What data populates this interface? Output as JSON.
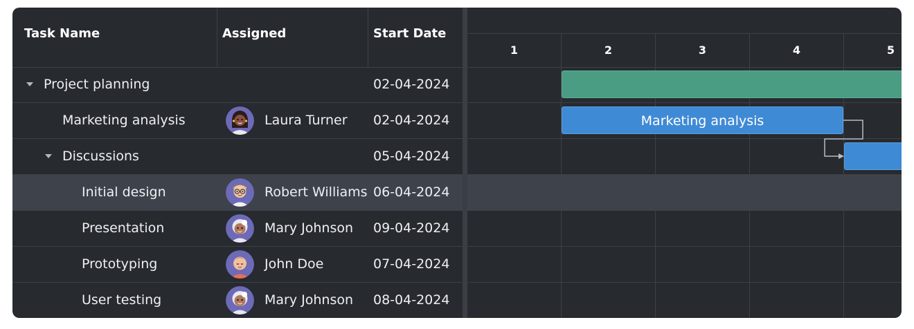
{
  "columns": {
    "task_name": "Task Name",
    "assigned": "Assigned",
    "start_date": "Start Date"
  },
  "timeline": {
    "days": [
      "1",
      "2",
      "3",
      "4",
      "5"
    ]
  },
  "rows": [
    {
      "name": "Project planning",
      "assigned": "",
      "start": "02-04-2024",
      "level": 0,
      "expandable": true,
      "selected": false
    },
    {
      "name": "Marketing analysis",
      "assigned": "Laura Turner",
      "start": "02-04-2024",
      "level": 1,
      "expandable": false,
      "selected": false
    },
    {
      "name": "Discussions",
      "assigned": "",
      "start": "05-04-2024",
      "level": 1,
      "expandable": true,
      "selected": false
    },
    {
      "name": "Initial design",
      "assigned": "Robert Williams",
      "start": "06-04-2024",
      "level": 2,
      "expandable": false,
      "selected": true
    },
    {
      "name": "Presentation",
      "assigned": "Mary Johnson",
      "start": "09-04-2024",
      "level": 2,
      "expandable": false,
      "selected": false
    },
    {
      "name": "Prototyping",
      "assigned": "John Doe",
      "start": "07-04-2024",
      "level": 2,
      "expandable": false,
      "selected": false
    },
    {
      "name": "User testing",
      "assigned": "Mary Johnson",
      "start": "08-04-2024",
      "level": 2,
      "expandable": false,
      "selected": false
    }
  ],
  "bars": {
    "project_planning": "",
    "marketing_analysis": "Marketing analysis",
    "discussions": ""
  },
  "colors": {
    "background": "#272a2e",
    "summary_bar": "#4a9c82",
    "task_bar": "#3f8ad5",
    "selected_row": "#3e424b"
  }
}
